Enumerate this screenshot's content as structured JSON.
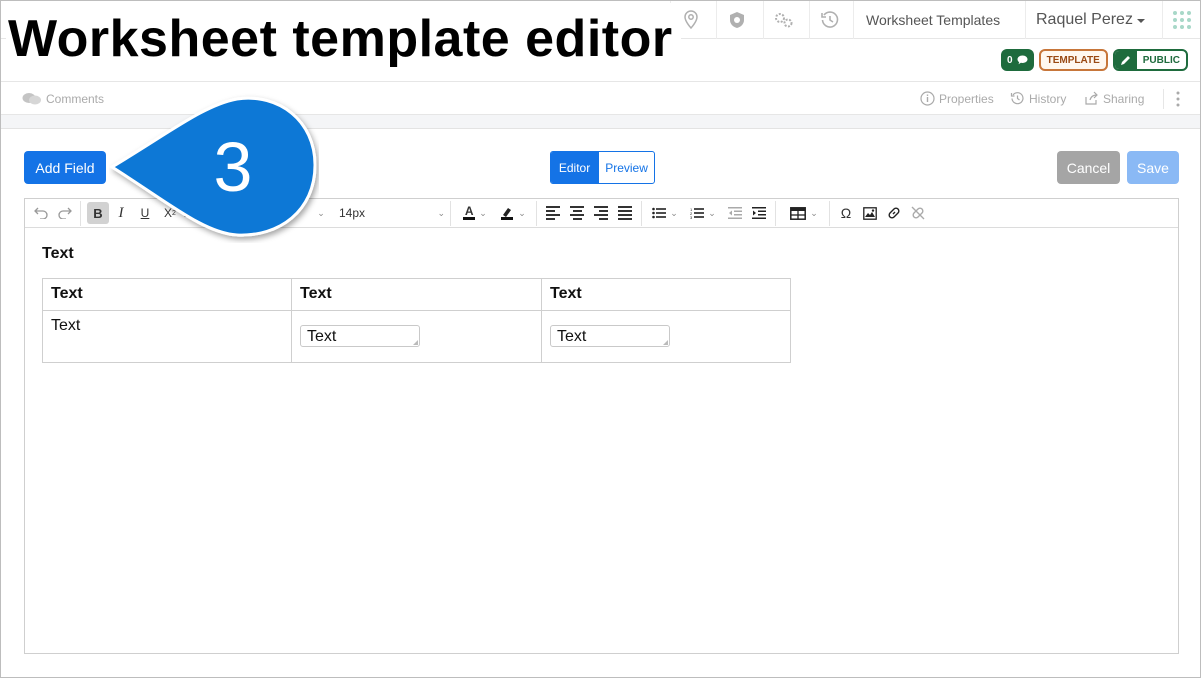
{
  "overlay": {
    "title": "Worksheet template editor",
    "step_number": "3"
  },
  "nav": {
    "worksheet_templates": "Worksheet Templates",
    "user_name": "Raquel Perez",
    "icons": [
      "location-icon",
      "shield-icon",
      "gears-icon",
      "history-icon",
      "apps-grid-icon"
    ]
  },
  "badges": {
    "count": "0",
    "template": "TEMPLATE",
    "public": "PUBLIC"
  },
  "subbar": {
    "comments": "Comments",
    "properties": "Properties",
    "history": "History",
    "sharing": "Sharing"
  },
  "actions": {
    "add_field": "Add Field",
    "editor": "Editor",
    "preview": "Preview",
    "cancel": "Cancel",
    "save": "Save"
  },
  "toolbar": {
    "font_size": "14px"
  },
  "document": {
    "heading": "Text",
    "table": {
      "header": [
        "Text",
        "Text",
        "Text"
      ],
      "row": {
        "label": "Text",
        "field1": "Text",
        "field2": "Text"
      }
    }
  },
  "colors": {
    "primary": "#1473e6",
    "callout": "#0b78d6",
    "badge_green": "#1e6b3d",
    "badge_orange": "#c7763a",
    "cancel_grey": "#a5a5a5",
    "save_disabled": "#8ab9f5"
  }
}
